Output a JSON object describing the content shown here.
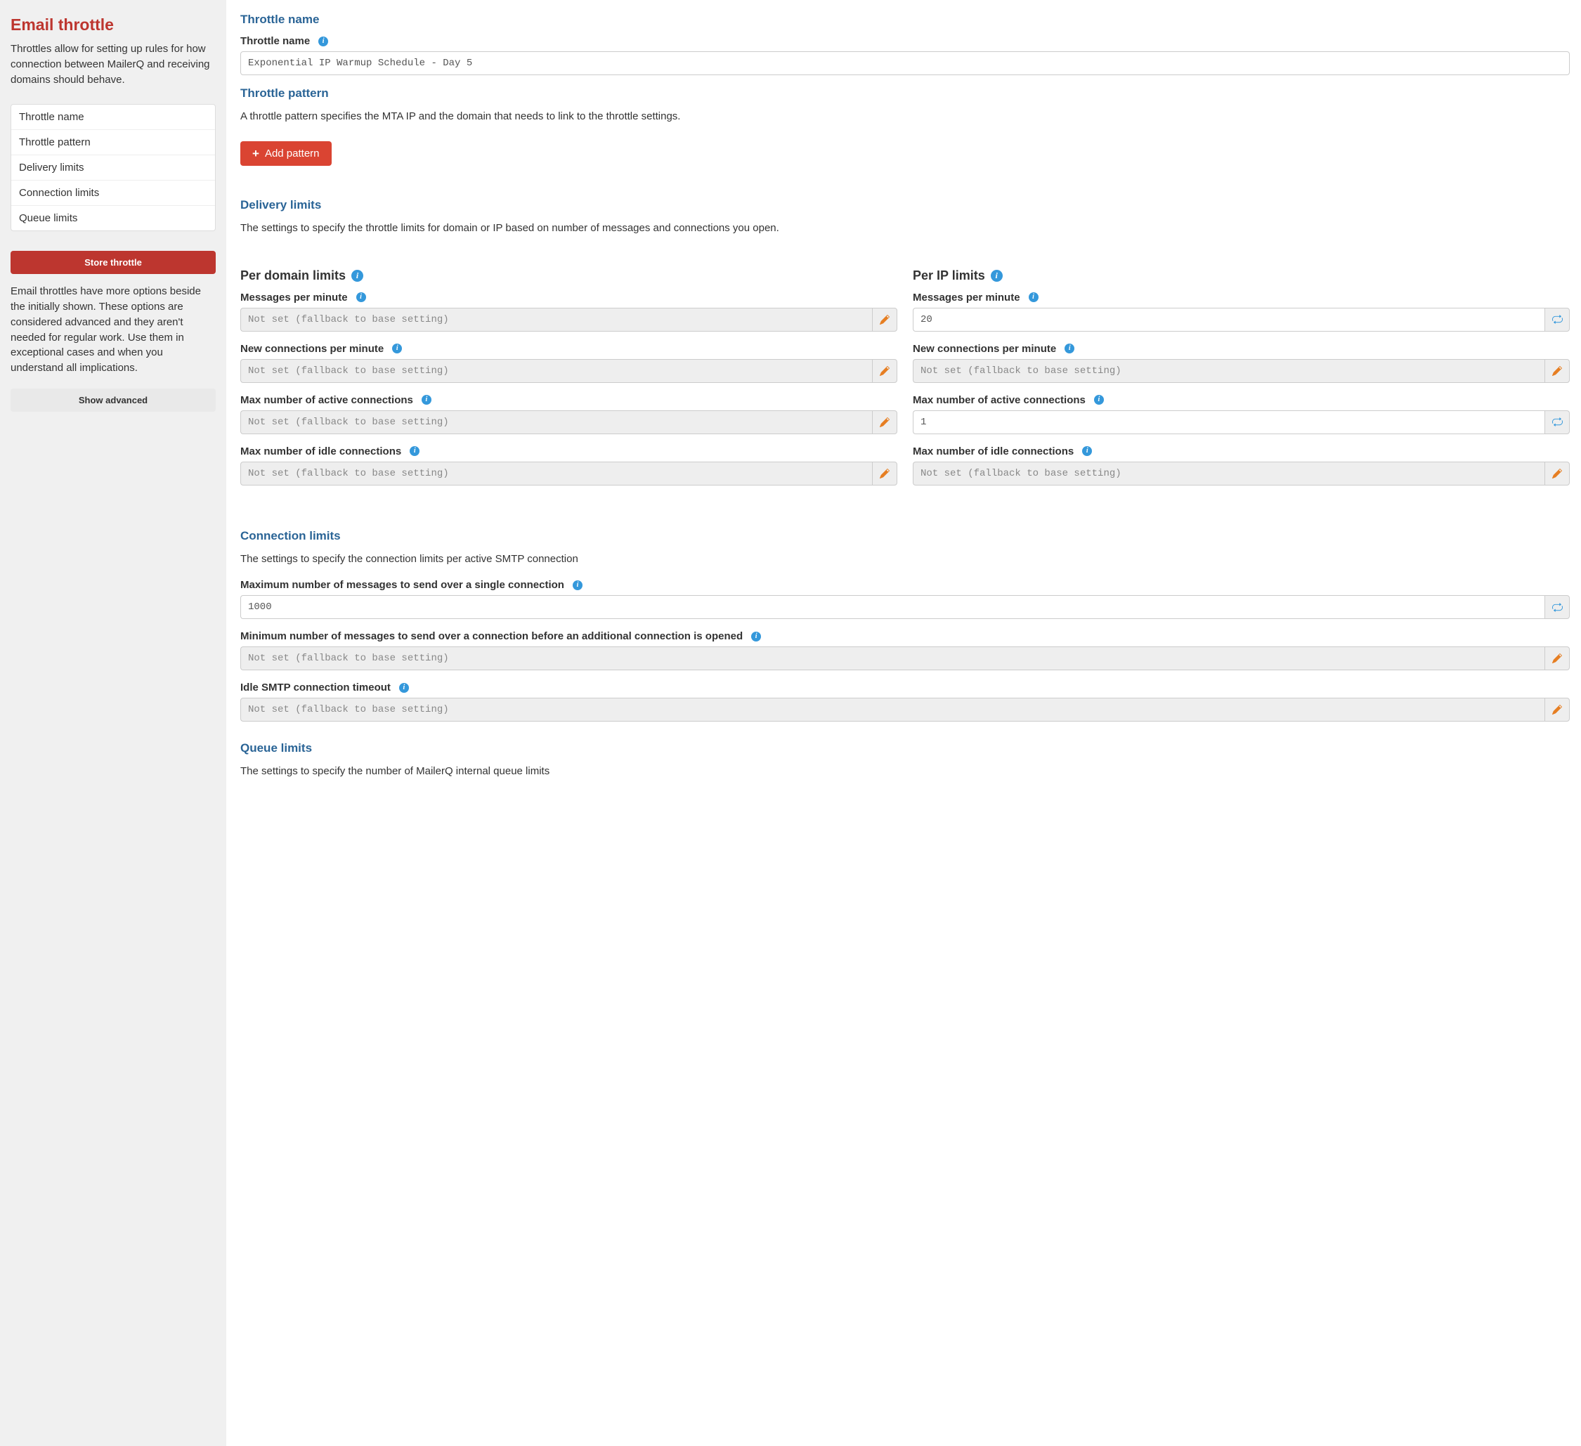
{
  "sidebar": {
    "title": "Email throttle",
    "intro": "Throttles allow for setting up rules for how connection between MailerQ and receiving domains should behave.",
    "nav": [
      "Throttle name",
      "Throttle pattern",
      "Delivery limits",
      "Connection limits",
      "Queue limits"
    ],
    "store_label": "Store throttle",
    "note": "Email throttles have more options beside the initially shown. These options are considered advanced and they aren't needed for regular work. Use them in exceptional cases and when you understand all implications.",
    "show_advanced_label": "Show advanced"
  },
  "placeholders": {
    "not_set": "Not set (fallback to base setting)"
  },
  "main": {
    "throttle_name": {
      "heading": "Throttle name",
      "label": "Throttle name",
      "value": "Exponential IP Warmup Schedule - Day 5"
    },
    "throttle_pattern": {
      "heading": "Throttle pattern",
      "description": "A throttle pattern specifies the MTA IP and the domain that needs to link to the throttle settings.",
      "add_label": "Add pattern"
    },
    "delivery_limits": {
      "heading": "Delivery limits",
      "description": "The settings to specify the throttle limits for domain or IP based on number of messages and connections you open.",
      "per_domain_heading": "Per domain limits",
      "per_ip_heading": "Per IP limits",
      "labels": {
        "messages_per_minute": "Messages per minute",
        "new_connections_per_minute": "New connections per minute",
        "max_active_connections": "Max number of active connections",
        "max_idle_connections": "Max number of idle connections"
      },
      "per_domain": {
        "messages_per_minute": "",
        "new_connections_per_minute": "",
        "max_active_connections": "",
        "max_idle_connections": ""
      },
      "per_ip": {
        "messages_per_minute": "20",
        "new_connections_per_minute": "",
        "max_active_connections": "1",
        "max_idle_connections": ""
      }
    },
    "connection_limits": {
      "heading": "Connection limits",
      "description": "The settings to specify the connection limits per active SMTP connection",
      "labels": {
        "max_messages_single": "Maximum number of messages to send over a single connection",
        "min_messages_before_additional": "Minimum number of messages to send over a connection before an additional connection is opened",
        "idle_timeout": "Idle SMTP connection timeout"
      },
      "values": {
        "max_messages_single": "1000",
        "min_messages_before_additional": "",
        "idle_timeout": ""
      }
    },
    "queue_limits": {
      "heading": "Queue limits",
      "description": "The settings to specify the number of MailerQ internal queue limits"
    }
  }
}
